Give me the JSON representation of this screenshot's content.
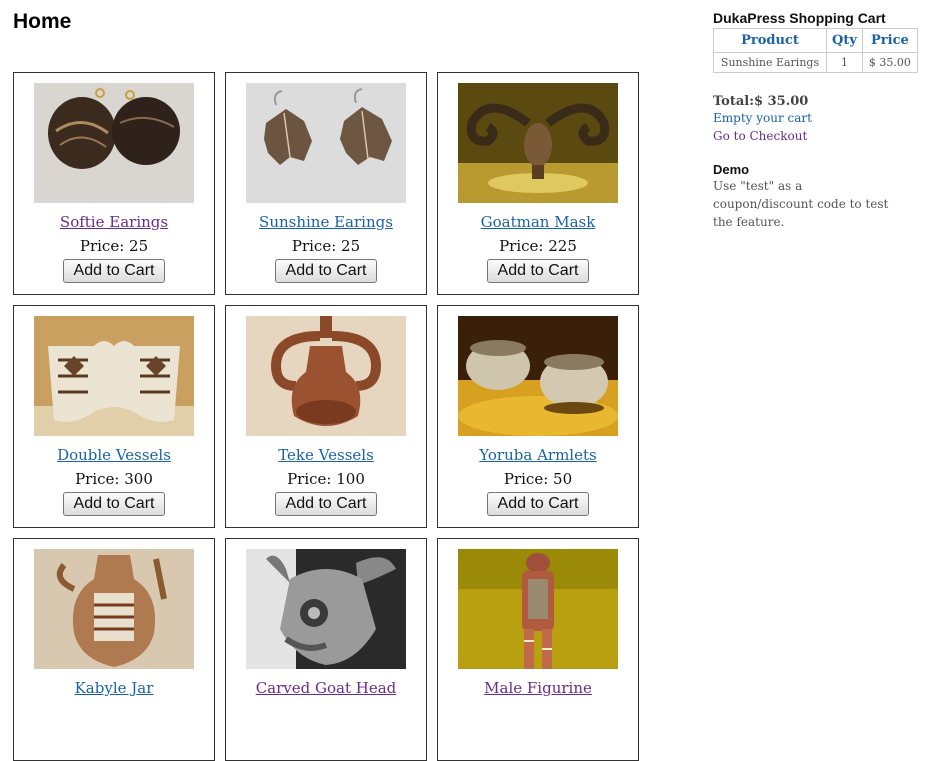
{
  "page": {
    "title": "Home"
  },
  "products": [
    {
      "name": "Softie Earings",
      "price_label": "Price: 25",
      "button": "Add to Cart",
      "image": "earrings-photo",
      "visited": true
    },
    {
      "name": "Sunshine Earings",
      "price_label": "Price: 25",
      "button": "Add to Cart",
      "image": "leaf-earrings-photo",
      "visited": false
    },
    {
      "name": "Goatman Mask",
      "price_label": "Price: 225",
      "button": "Add to Cart",
      "image": "mask-photo",
      "visited": false
    },
    {
      "name": "Double Vessels",
      "price_label": "Price: 300",
      "button": "Add to Cart",
      "image": "vessels-photo",
      "visited": false
    },
    {
      "name": "Teke Vessels",
      "price_label": "Price: 100",
      "button": "Add to Cart",
      "image": "teke-vessel-photo",
      "visited": false
    },
    {
      "name": "Yoruba Armlets",
      "price_label": "Price: 50",
      "button": "Add to Cart",
      "image": "armlets-photo",
      "visited": false
    },
    {
      "name": "Kabyle Jar",
      "price_label": "",
      "button": "",
      "image": "jar-photo",
      "visited": false
    },
    {
      "name": "Carved Goat Head",
      "price_label": "",
      "button": "",
      "image": "goat-head-photo",
      "visited": true
    },
    {
      "name": "Male Figurine",
      "price_label": "",
      "button": "",
      "image": "figurine-photo",
      "visited": true
    }
  ],
  "cart": {
    "title": "DukaPress Shopping Cart",
    "headers": [
      "Product",
      "Qty",
      "Price"
    ],
    "rows": [
      {
        "product": "Sunshine Earings",
        "qty": "1",
        "price": "$ 35.00"
      }
    ],
    "total_label": "Total:",
    "total_value": "$ 35.00",
    "empty_link": "Empty your cart",
    "checkout_link": "Go to Checkout"
  },
  "demo": {
    "title": "Demo",
    "text": "Use \"test\" as a coupon/discount code to test the feature."
  },
  "colors": {
    "link": "#1a62a8",
    "visited": "#6a2a8e",
    "border": "#333333"
  }
}
